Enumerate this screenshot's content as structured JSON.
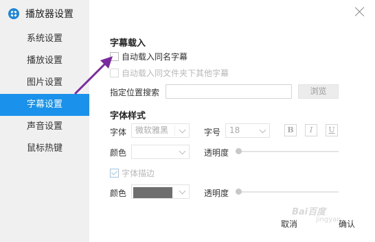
{
  "app": {
    "title": "播放器设置",
    "logo_icon": "player-logo-icon"
  },
  "window": {
    "close_icon": "close-icon"
  },
  "sidebar": {
    "items": [
      {
        "label": "系统设置",
        "active": false
      },
      {
        "label": "播放设置",
        "active": false
      },
      {
        "label": "图片设置",
        "active": false
      },
      {
        "label": "字幕设置",
        "active": true
      },
      {
        "label": "声音设置",
        "active": false
      },
      {
        "label": "鼠标热键",
        "active": false
      }
    ],
    "active_color": "#1a91eb"
  },
  "subtitle_load": {
    "title": "字幕载入",
    "auto_load_same_name": {
      "label": "自动载入同名字幕",
      "checked": false
    },
    "auto_load_other_in_folder": {
      "label": "自动载入同文件夹下其他字幕",
      "checked": false,
      "disabled": true
    },
    "search_location_label": "指定位置搜索",
    "search_location_value": "",
    "browse_label": "浏览"
  },
  "font_style": {
    "title": "字体样式",
    "font_label": "字体",
    "font_value": "微软雅黑",
    "size_label": "字号",
    "size_value": "18",
    "bold_label": "B",
    "italic_label": "I",
    "underline_label": "U",
    "color_label": "颜色",
    "color_value": "#ffffff",
    "opacity_label": "透明度",
    "outline": {
      "label": "字体描边",
      "checked": true,
      "disabled": true
    },
    "outline_color_label": "颜色",
    "outline_color_value": "#6e6e6e",
    "outline_opacity_label": "透明度"
  },
  "footer": {
    "cancel_label": "取消",
    "ok_label": "确认"
  },
  "annotation": {
    "arrow_color": "#7b2aa0"
  },
  "watermark": {
    "text": "Bai百度",
    "sub": "jingyan"
  }
}
